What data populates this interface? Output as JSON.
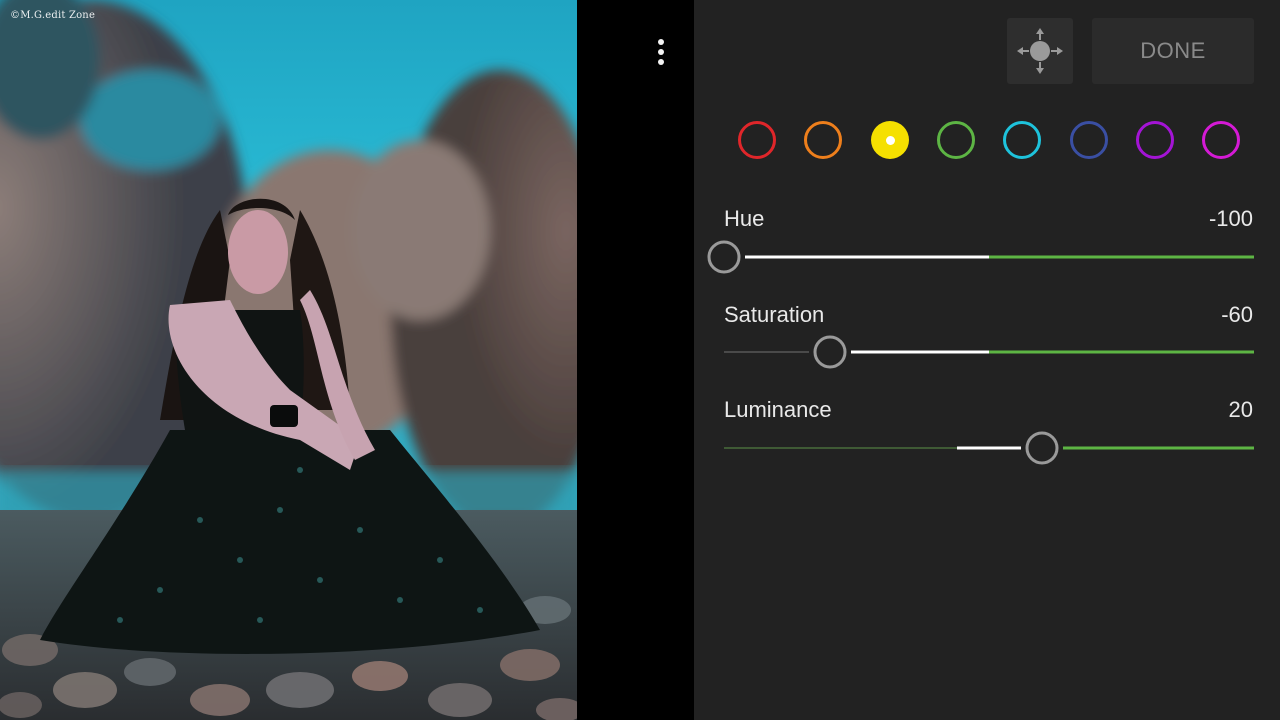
{
  "photo": {
    "watermark": "©M.G.edit Zone",
    "description_icon": "photo-preview"
  },
  "toolbar": {
    "more_icon": "more-vertical-icon",
    "move_icon": "move-target-icon",
    "done_label": "DONE"
  },
  "colors": {
    "panel_bg": "#222222",
    "accent_green": "#5db544",
    "slider_white": "#ffffff",
    "selected_swatch": "#f5e000"
  },
  "swatches": [
    {
      "name": "red",
      "color": "#e0262a",
      "selected": false
    },
    {
      "name": "orange",
      "color": "#ee7f1c",
      "selected": false
    },
    {
      "name": "yellow",
      "color": "#f5e000",
      "selected": true
    },
    {
      "name": "green",
      "color": "#5db544",
      "selected": false
    },
    {
      "name": "aqua",
      "color": "#1ec3dc",
      "selected": false
    },
    {
      "name": "blue",
      "color": "#3a4fa3",
      "selected": false
    },
    {
      "name": "purple",
      "color": "#a414d6",
      "selected": false
    },
    {
      "name": "magenta",
      "color": "#d51ad6",
      "selected": false
    }
  ],
  "sliders": [
    {
      "id": "hue",
      "label": "Hue",
      "value_text": "-100",
      "value": -100,
      "min": -100,
      "max": 100
    },
    {
      "id": "saturation",
      "label": "Saturation",
      "value_text": "-60",
      "value": -60,
      "min": -100,
      "max": 100
    },
    {
      "id": "luminance",
      "label": "Luminance",
      "value_text": "20",
      "value": 20,
      "min": -100,
      "max": 100
    }
  ]
}
